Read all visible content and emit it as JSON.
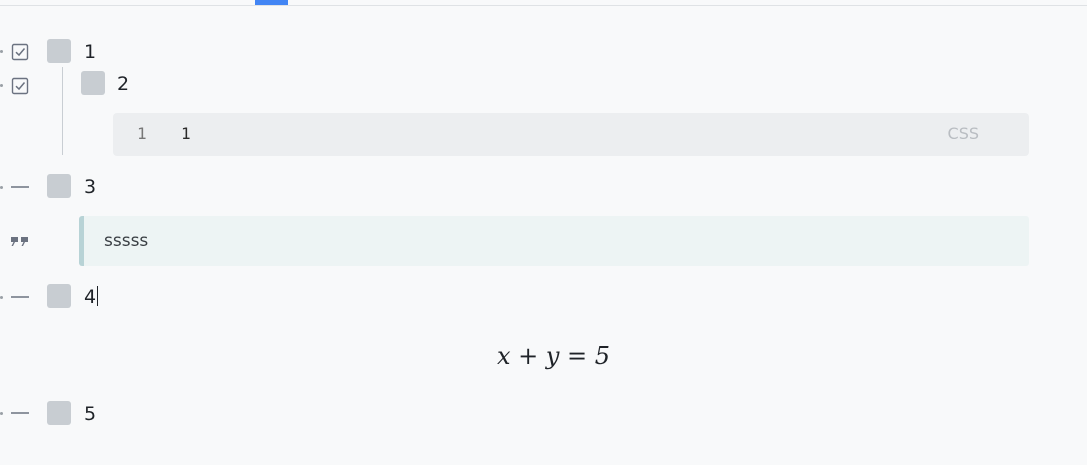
{
  "items": [
    {
      "label": "1",
      "type_icon": "checklist-icon"
    },
    {
      "label": "2",
      "type_icon": "checklist-icon"
    },
    {
      "label": "3",
      "type_icon": "divider-icon"
    },
    {
      "label": "4",
      "type_icon": "divider-icon"
    },
    {
      "label": "5",
      "type_icon": "divider-icon"
    }
  ],
  "code_block": {
    "line_number": "1",
    "content": "1",
    "language": "CSS"
  },
  "quote": {
    "text": "sssss",
    "type_icon": "quote-icon"
  },
  "math": {
    "formula": "x + y = 5"
  },
  "colors": {
    "accent": "#4285f4",
    "checkbox": "#c8cdd2",
    "code_bg": "#eceef0",
    "quote_bg": "#edf4f4",
    "quote_border": "#b8d3d6"
  }
}
